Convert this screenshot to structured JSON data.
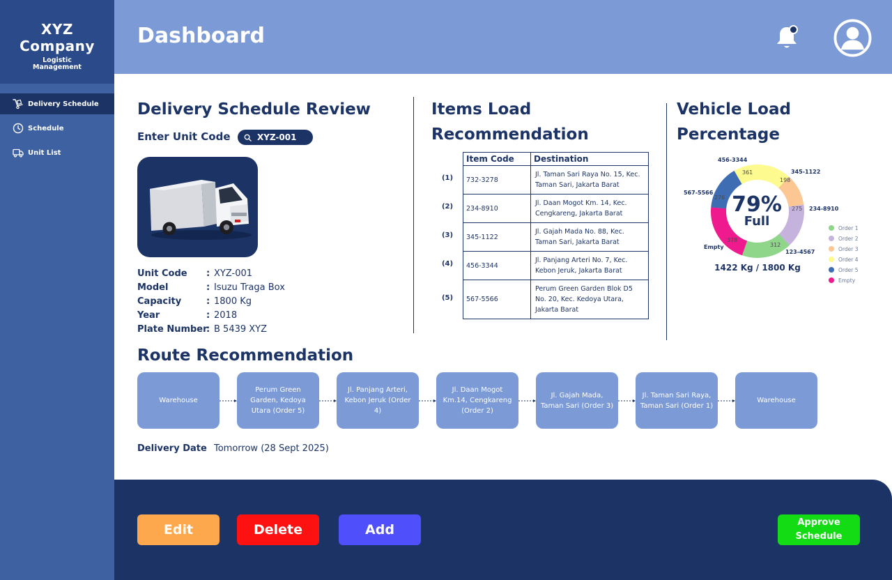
{
  "brand": {
    "name_line1": "XYZ",
    "name_line2": "Company",
    "subtitle_line1": "Logistic",
    "subtitle_line2": "Management"
  },
  "sidebar": {
    "items": [
      {
        "label": "Delivery Schedule",
        "icon": "dolly-icon",
        "active": true
      },
      {
        "label": "Schedule",
        "icon": "clock-icon",
        "active": false
      },
      {
        "label": "Unit List",
        "icon": "truck-icon",
        "active": false
      }
    ]
  },
  "header": {
    "title": "Dashboard",
    "bell_icon": "bell-icon",
    "avatar_icon": "user-icon"
  },
  "review": {
    "title": "Delivery Schedule Review",
    "unit_code_label": "Enter Unit Code",
    "unit_code_value": "XYZ-001",
    "specs": [
      {
        "key": "Unit Code",
        "value": "XYZ-001"
      },
      {
        "key": "Model",
        "value": "Isuzu Traga Box"
      },
      {
        "key": "Capacity",
        "value": "1800 Kg"
      },
      {
        "key": "Year",
        "value": "2018"
      },
      {
        "key": "Plate Number",
        "value": "B 5439 XYZ"
      }
    ]
  },
  "items_load": {
    "title_line1": "Items Load",
    "title_line2": "Recommendation",
    "headers": [
      "Item Code",
      "Destination"
    ],
    "rows": [
      {
        "index": "(1)",
        "code": "732-3278",
        "dest": "Jl. Taman Sari Raya No. 15, Kec. Taman Sari, Jakarta Barat"
      },
      {
        "index": "(2)",
        "code": "234-8910",
        "dest": "Jl. Daan Mogot Km. 14, Kec. Cengkareng, Jakarta Barat"
      },
      {
        "index": "(3)",
        "code": "345-1122",
        "dest": "Jl. Gajah Mada No. 88, Kec. Taman Sari, Jakarta Barat"
      },
      {
        "index": "(4)",
        "code": "456-3344",
        "dest": "Jl. Panjang Arteri No. 7, Kec. Kebon Jeruk, Jakarta Barat"
      },
      {
        "index": "(5)",
        "code": "567-5566",
        "dest": "Perum Green Garden Blok D5 No. 20, Kec. Kedoya Utara, Jakarta Barat"
      }
    ]
  },
  "vehicle_load": {
    "title_line1": "Vehicle Load",
    "title_line2": "Percentage",
    "percent": "79%",
    "status": "Full",
    "total": "1422 Kg / 1800 Kg",
    "segments": [
      {
        "label": "456-3344",
        "value": "361",
        "amount": 361,
        "color": "#fdfa8f"
      },
      {
        "label": "345-1122",
        "value": "198",
        "amount": 198,
        "color": "#fcc792"
      },
      {
        "label": "234-8910",
        "value": "275",
        "amount": 275,
        "color": "#c6b3dd"
      },
      {
        "label": "123-4567",
        "value": "312",
        "amount": 312,
        "color": "#8fd58a"
      },
      {
        "label": "Empty",
        "value": "378",
        "amount": 378,
        "color": "#ee1a8e"
      },
      {
        "label": "567-5566",
        "value": "276",
        "amount": 276,
        "color": "#3f6db3"
      }
    ],
    "legend": [
      {
        "label": "Order 1",
        "color": "#8fd58a"
      },
      {
        "label": "Order 2",
        "color": "#c6b3dd"
      },
      {
        "label": "Order 3",
        "color": "#fcc792"
      },
      {
        "label": "Order 4",
        "color": "#fdfa8f"
      },
      {
        "label": "Order 5",
        "color": "#3f6db3"
      },
      {
        "label": "Empty",
        "color": "#ee1a8e"
      }
    ]
  },
  "route": {
    "title": "Route Recommendation",
    "stops": [
      "Warehouse",
      "Perum Green Garden, Kedoya Utara (Order 5)",
      "Jl. Panjang Arteri, Kebon Jeruk (Order 4)",
      "Jl. Daan Mogot Km.14, Cengkareng (Order 2)",
      "Jl. Gajah Mada, Taman Sari (Order 3)",
      "Jl. Taman Sari Raya, Taman Sari (Order 1)",
      "Warehouse"
    ],
    "date_label": "Delivery Date",
    "date_value": "Tomorrow (28 Sept 2025)"
  },
  "actions": {
    "edit": "Edit",
    "edit_color": "#fea84d",
    "delete": "Delete",
    "delete_color": "#fe1111",
    "add": "Add",
    "add_color": "#4f4ffb",
    "approve_line1": "Approve",
    "approve_line2": "Schedule",
    "approve_color": "#14dc14"
  }
}
